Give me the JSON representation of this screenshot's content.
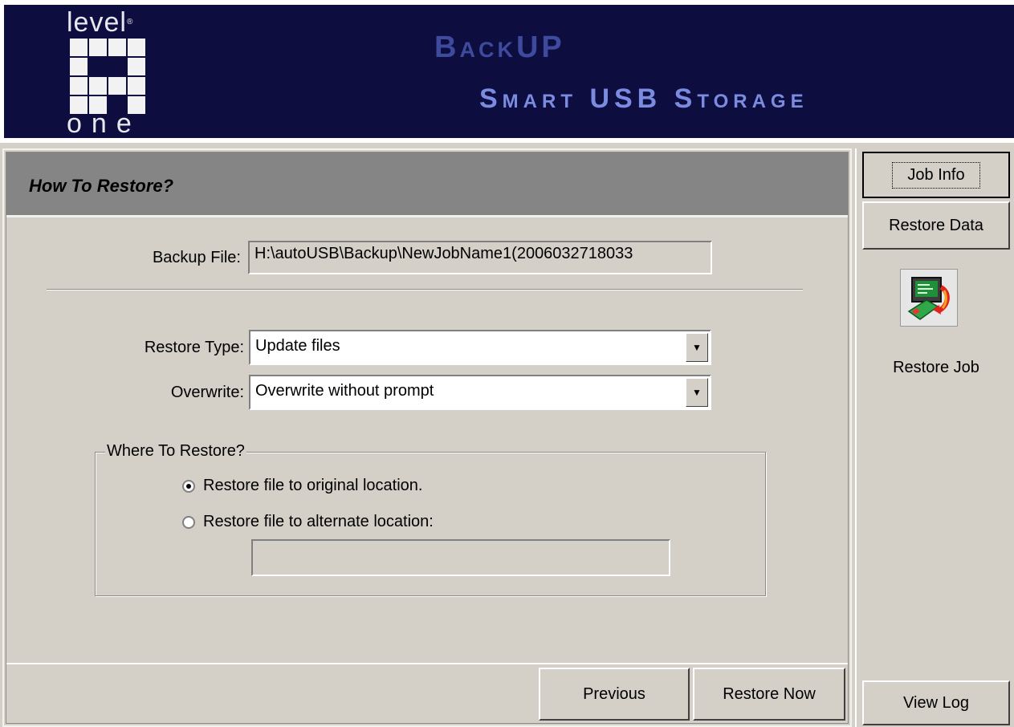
{
  "header": {
    "logo_top": "level",
    "logo_mark": "®",
    "logo_bottom": "one",
    "title_line1": "BackUP",
    "title_line2": "Smart USB Storage"
  },
  "section": {
    "title": "How To Restore?"
  },
  "form": {
    "backup_file_label": "Backup File:",
    "backup_file_value": "H:\\autoUSB\\Backup\\NewJobName1(2006032718033",
    "restore_type_label": "Restore Type:",
    "restore_type_value": "Update files",
    "overwrite_label": "Overwrite:",
    "overwrite_value": "Overwrite without prompt"
  },
  "where": {
    "group_title": "Where To Restore?",
    "option_original": "Restore file to original location.",
    "option_alternate": "Restore file to alternate location:",
    "selected": "original",
    "alternate_path": ""
  },
  "footer": {
    "previous_label": "Previous",
    "restore_now_label": "Restore Now"
  },
  "sidebar": {
    "job_info_label": "Job Info",
    "restore_data_label": "Restore Data",
    "restore_job_label": "Restore Job",
    "restore_job_icon": "restore-job-icon",
    "view_log_label": "View Log"
  },
  "colors": {
    "header_bg": "#0d0e3f",
    "panel_bg": "#d4d0c8",
    "section_head_bg": "#858585"
  }
}
